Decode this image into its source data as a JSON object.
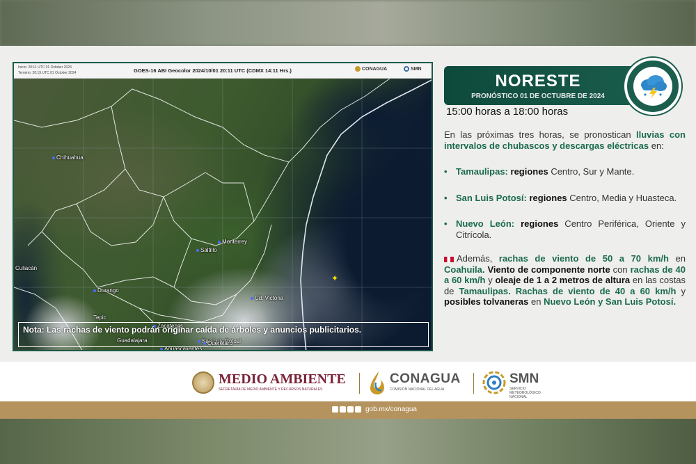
{
  "map": {
    "inicio": "Inicio: 20:11 UTC 01 October 2024",
    "termino": "Termino: 20:19 UTC 01 October 2024",
    "title": "GOES-16 ABI Geocolor 2024/10/01 20:11 UTC (CDMX  14:11 Hrs.)",
    "logo_conagua": "CONAGUA",
    "logo_smn": "SMN",
    "cities": {
      "chihuahua": "Chihuahua",
      "monterrey": "Monterrey",
      "saltillo": "Saltillo",
      "culiacan": "Culiacán",
      "durango": "Durango",
      "victoria": "Cd. Victoria",
      "zacatecas": "Zacatecas",
      "slp": "San Luis Potosí",
      "ags": "Aguascalientes",
      "tepic": "Tepic",
      "gdl": "Guadalajara",
      "qro": "Querétaro"
    },
    "note": "Nota: Las rachas de viento podrán originar caída de árboles y anuncios publicitarios."
  },
  "banner": {
    "title": "NORESTE",
    "subtitle": "PRONÓSTICO 01 DE OCTUBRE DE 2024",
    "icon": "storm-cloud-icon"
  },
  "hours": "15:00 horas a 18:00 horas",
  "forecast": {
    "intro_a": "En las próximas tres horas, se pronostican ",
    "intro_b": "lluvias con intervalos de chubascos y descargas eléctricas",
    "intro_c": " en:",
    "items": [
      {
        "state": "Tamaulipas:",
        "regions_word": "regiones",
        "regions": " Centro, Sur y Mante."
      },
      {
        "state": "San Luis Potosí:",
        "regions_word": "regiones",
        "regions": " Centro, Media y Huasteca."
      },
      {
        "state": "Nuevo León:",
        "regions_word": "regiones",
        "regions": " Centro Periférica, Oriente y Citrícola."
      }
    ],
    "bullet": "•",
    "extra": {
      "t1": "Además, ",
      "t2": "rachas de viento de 50 a 70 km/h",
      "t3": " en ",
      "t4": "Coahuila.",
      "t5": " Viento de componente norte",
      "t6": " con ",
      "t7": "rachas de 40 a 60 km/h",
      "t8": " y ",
      "t9": "oleaje de 1 a 2 metros de altura",
      "t10": " en las costas de ",
      "t11": "Tamaulipas.",
      "t12": " ",
      "t13": "Rachas de viento de 40 a 60 km/h",
      "t14": " y ",
      "t15": "posibles tolvaneras",
      "t16": " en ",
      "t17": "Nuevo León y San Luis Potosí."
    }
  },
  "footer": {
    "ma_title": "MEDIO AMBIENTE",
    "ma_sub": "SECRETARÍA DE MEDIO AMBIENTE Y RECURSOS NATURALES",
    "conagua_title": "CONAGUA",
    "conagua_sub": "COMISIÓN NACIONAL DEL AGUA",
    "smn_title": "SMN",
    "smn_sub": "SERVICIO METEOROLÓGICO NACIONAL",
    "url": "gob.mx/conagua"
  },
  "colors": {
    "green_dark": "#0e4a3c",
    "green_text": "#1b6b50",
    "gold": "#b5935e",
    "wine": "#7a2238"
  }
}
